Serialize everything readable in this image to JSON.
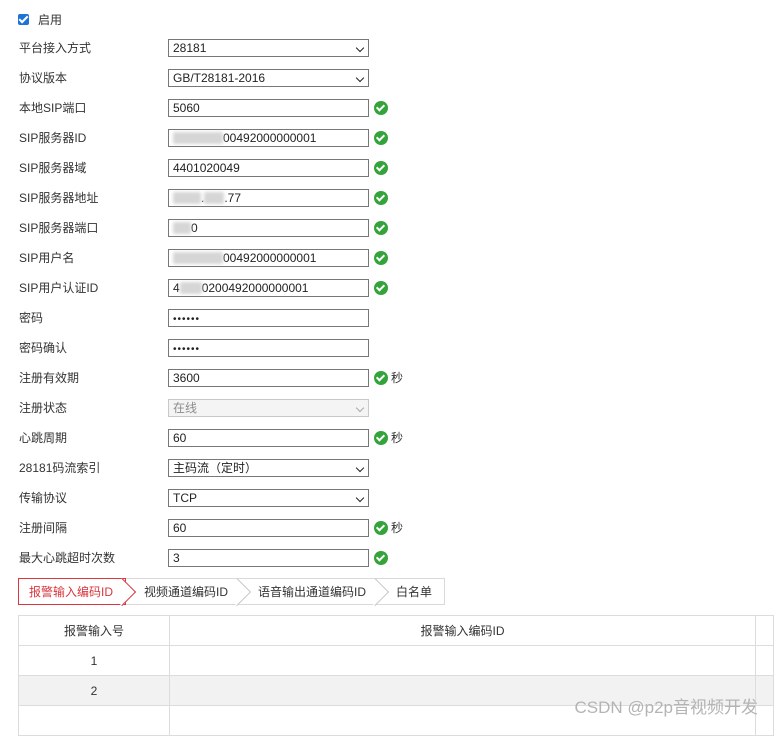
{
  "enable": {
    "label": "启用",
    "checked": true
  },
  "form": {
    "access_mode": {
      "label": "平台接入方式",
      "value": "28181"
    },
    "protocol_version": {
      "label": "协议版本",
      "value": "GB/T28181-2016"
    },
    "local_sip_port": {
      "label": "本地SIP端口",
      "value": "5060"
    },
    "sip_server_id": {
      "label": "SIP服务器ID",
      "value": "00492000000001"
    },
    "sip_server_domain": {
      "label": "SIP服务器域",
      "value": "4401020049"
    },
    "sip_server_address": {
      "label": "SIP服务器地址",
      "value_a": ".",
      "value_b": ".77"
    },
    "sip_server_port": {
      "label": "SIP服务器端口",
      "value": "0"
    },
    "sip_username": {
      "label": "SIP用户名",
      "value": "00492000000001"
    },
    "sip_auth_id": {
      "label": "SIP用户认证ID",
      "value_a": "4",
      "value_b": "0200492000000001"
    },
    "password": {
      "label": "密码",
      "value": "••••••"
    },
    "password_confirm": {
      "label": "密码确认",
      "value": "••••••"
    },
    "registration_validity": {
      "label": "注册有效期",
      "value": "3600",
      "unit": "秒"
    },
    "registration_status": {
      "label": "注册状态",
      "value": "在线"
    },
    "heartbeat_period": {
      "label": "心跳周期",
      "value": "60",
      "unit": "秒"
    },
    "stream_index": {
      "label": "28181码流索引",
      "value": "主码流（定时）"
    },
    "transport_protocol": {
      "label": "传输协议",
      "value": "TCP"
    },
    "registration_interval": {
      "label": "注册间隔",
      "value": "60",
      "unit": "秒"
    },
    "max_heartbeat_timeouts": {
      "label": "最大心跳超时次数",
      "value": "3"
    }
  },
  "tabs": [
    "报警输入编码ID",
    "视频通道编码ID",
    "语音输出通道编码ID",
    "白名单"
  ],
  "table": {
    "headers": [
      "报警输入号",
      "报警输入编码ID"
    ],
    "rows": [
      [
        "1",
        ""
      ],
      [
        "2",
        ""
      ]
    ]
  },
  "watermark": "CSDN @p2p音视频开发",
  "colors": {
    "accent_red": "#d9363e",
    "ok_green": "#33a33a",
    "checkbox_blue": "#1e73d8"
  },
  "icons": {
    "ok": "check-circle-icon",
    "dropdown": "chevron-down-icon",
    "checkbox": "checkbox-checked-icon"
  }
}
